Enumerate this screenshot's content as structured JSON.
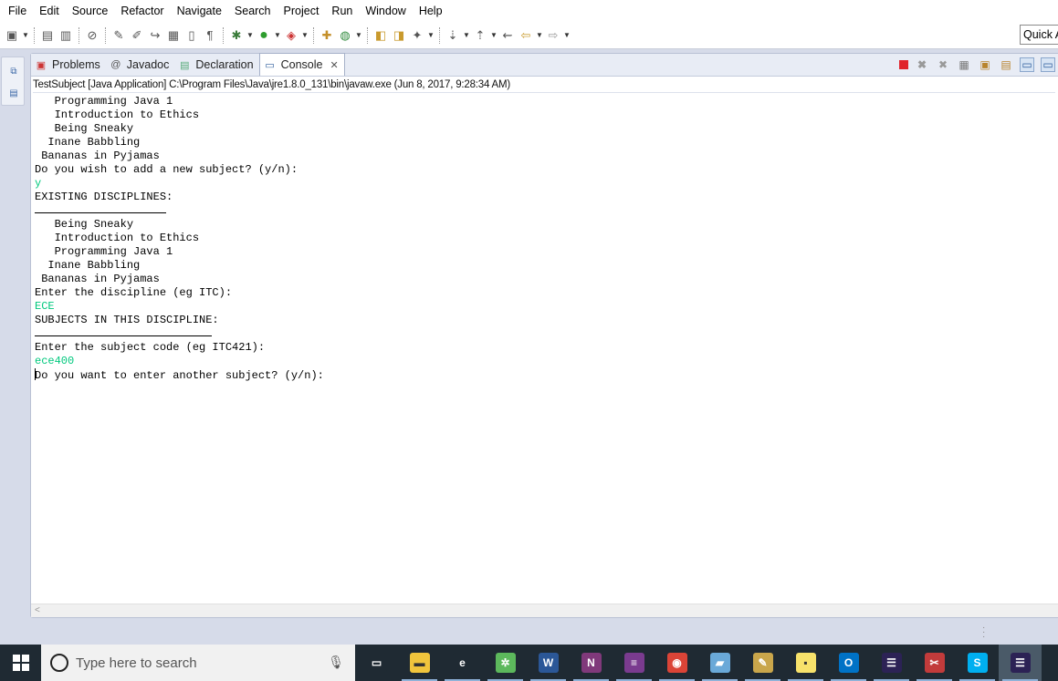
{
  "menu": [
    "File",
    "Edit",
    "Source",
    "Refactor",
    "Navigate",
    "Search",
    "Project",
    "Run",
    "Window",
    "Help"
  ],
  "toolbar": {
    "quick_access": "Quick A",
    "icons": [
      "new-file-icon",
      "save-icon",
      "save-all-icon",
      "skip-breakpoints-icon",
      "debug-icon",
      "run-icon",
      "external-tools-icon",
      "new-java-project-icon",
      "open-type-icon",
      "search-icon",
      "next-annotation-icon",
      "back-icon",
      "forward-icon"
    ]
  },
  "tabs": [
    {
      "label": "Problems",
      "icon": "problems-icon",
      "active": false
    },
    {
      "label": "Javadoc",
      "icon": "at-icon",
      "active": false
    },
    {
      "label": "Declaration",
      "icon": "declaration-icon",
      "active": false
    },
    {
      "label": "Console",
      "icon": "console-icon",
      "active": true
    }
  ],
  "console": {
    "description": "TestSubject [Java Application] C:\\Program Files\\Java\\jre1.8.0_131\\bin\\javaw.exe (Jun 8, 2017, 9:28:34 AM)",
    "lines": [
      {
        "text": "   Programming Java 1",
        "kind": "out"
      },
      {
        "text": "   Introduction to Ethics",
        "kind": "out"
      },
      {
        "text": "   Being Sneaky",
        "kind": "out"
      },
      {
        "text": "  Inane Babbling",
        "kind": "out"
      },
      {
        "text": " Bananas in Pyjamas",
        "kind": "out"
      },
      {
        "text": "Do you wish to add a new subject? (y/n):",
        "kind": "out"
      },
      {
        "text": "y",
        "kind": "input"
      },
      {
        "text": "EXISTING DISCIPLINES:",
        "kind": "out"
      },
      {
        "text": "",
        "kind": "rule",
        "width_chars": 20
      },
      {
        "text": "   Being Sneaky",
        "kind": "out"
      },
      {
        "text": "   Introduction to Ethics",
        "kind": "out"
      },
      {
        "text": "   Programming Java 1",
        "kind": "out"
      },
      {
        "text": "  Inane Babbling",
        "kind": "out"
      },
      {
        "text": " Bananas in Pyjamas",
        "kind": "out"
      },
      {
        "text": "Enter the discipline (eg ITC):",
        "kind": "out"
      },
      {
        "text": "ECE",
        "kind": "input"
      },
      {
        "text": "SUBJECTS IN THIS DISCIPLINE:",
        "kind": "out"
      },
      {
        "text": "",
        "kind": "rule",
        "width_chars": 27
      },
      {
        "text": "Enter the subject code (eg ITC421):",
        "kind": "out"
      },
      {
        "text": "ece400",
        "kind": "input"
      },
      {
        "text": "Do you want to enter another subject? (y/n):",
        "kind": "caret"
      }
    ]
  },
  "taskbar": {
    "search_placeholder": "Type here to search",
    "apps": [
      {
        "name": "task-view-icon",
        "glyph": "▭",
        "color": "#1f2a33"
      },
      {
        "name": "file-explorer-icon",
        "glyph": "▬",
        "color": "#f0c43c"
      },
      {
        "name": "edge-icon",
        "glyph": "e",
        "color": "#1f2a33"
      },
      {
        "name": "globe-app-icon",
        "glyph": "✲",
        "color": "#5cb85c"
      },
      {
        "name": "word-icon",
        "glyph": "W",
        "color": "#2b5797"
      },
      {
        "name": "onenote-icon",
        "glyph": "N",
        "color": "#80397b"
      },
      {
        "name": "winrar-icon",
        "glyph": "≡",
        "color": "#7a3b8f"
      },
      {
        "name": "chrome-icon",
        "glyph": "◉",
        "color": "#db4437"
      },
      {
        "name": "notepad-icon",
        "glyph": "▰",
        "color": "#6aa9d8"
      },
      {
        "name": "paint-icon",
        "glyph": "✎",
        "color": "#c9a64b"
      },
      {
        "name": "sticky-notes-icon",
        "glyph": "▪",
        "color": "#f7e26b"
      },
      {
        "name": "outlook-icon",
        "glyph": "O",
        "color": "#0072c6"
      },
      {
        "name": "eclipse-icon",
        "glyph": "☰",
        "color": "#2c2255"
      },
      {
        "name": "snipping-tool-icon",
        "glyph": "✂",
        "color": "#c23b3b"
      },
      {
        "name": "skype-icon",
        "glyph": "S",
        "color": "#00aff0"
      },
      {
        "name": "eclipse-active-icon",
        "glyph": "☰",
        "color": "#2c2255"
      }
    ]
  }
}
